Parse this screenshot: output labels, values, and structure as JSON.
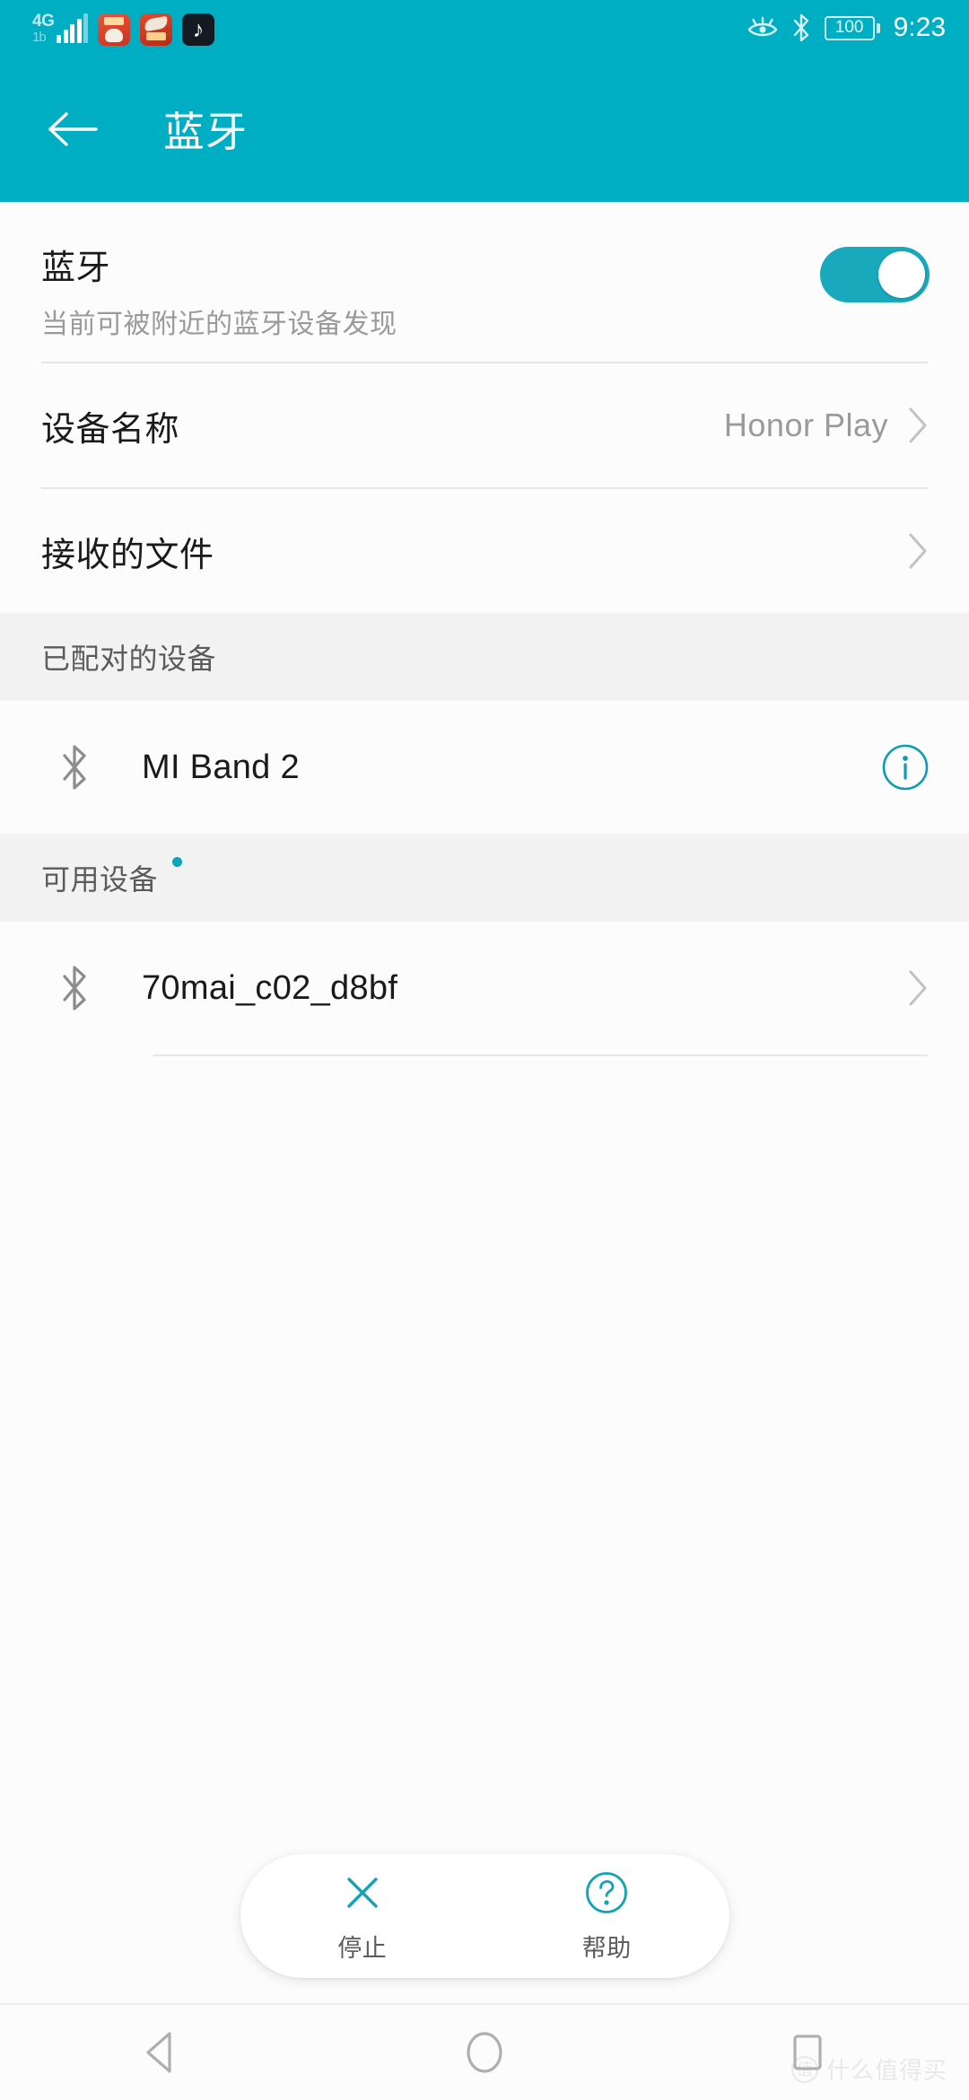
{
  "theme": {
    "accent": "#00AEC4",
    "toggle_on": "#18A9BC",
    "info_icon": "#0E9CB2",
    "section_bg": "#F2F2F2",
    "content_bg": "#FCFCFC"
  },
  "status_bar": {
    "network_label": "4G",
    "network_sublabel": "1b",
    "signal_bars": 4,
    "app_icons": [
      "jd-festival-icon",
      "jd-redpacket-icon",
      "douyin-icon"
    ],
    "eye_comfort_icon": "eye-comfort-icon",
    "bluetooth_icon": "bluetooth-icon",
    "battery_level": "100",
    "time": "9:23"
  },
  "app_bar": {
    "back_icon": "back-arrow-icon",
    "title": "蓝牙"
  },
  "bluetooth_toggle": {
    "title": "蓝牙",
    "subtitle": "当前可被附近的蓝牙设备发现",
    "state": "on"
  },
  "settings_rows": [
    {
      "title": "设备名称",
      "value": "Honor Play",
      "chevron": true
    },
    {
      "title": "接收的文件",
      "value": "",
      "chevron": true
    }
  ],
  "paired_section": {
    "header": "已配对的设备",
    "devices": [
      {
        "name": "MI Band 2",
        "icon": "bluetooth-icon",
        "trailing": "info-icon"
      }
    ]
  },
  "available_section": {
    "header": "可用设备",
    "scanning": true,
    "devices": [
      {
        "name": "70mai_c02_d8bf",
        "icon": "bluetooth-icon",
        "trailing": "chevron-right-icon"
      }
    ]
  },
  "action_bar": {
    "items": [
      {
        "icon": "close-x-icon",
        "label": "停止"
      },
      {
        "icon": "help-question-icon",
        "label": "帮助"
      }
    ]
  },
  "nav_bar": {
    "back_icon": "nav-back-triangle-icon",
    "home_icon": "nav-home-circle-icon",
    "recents_icon": "nav-recents-square-icon"
  },
  "watermark": {
    "badge": "值",
    "text": "什么值得买"
  }
}
